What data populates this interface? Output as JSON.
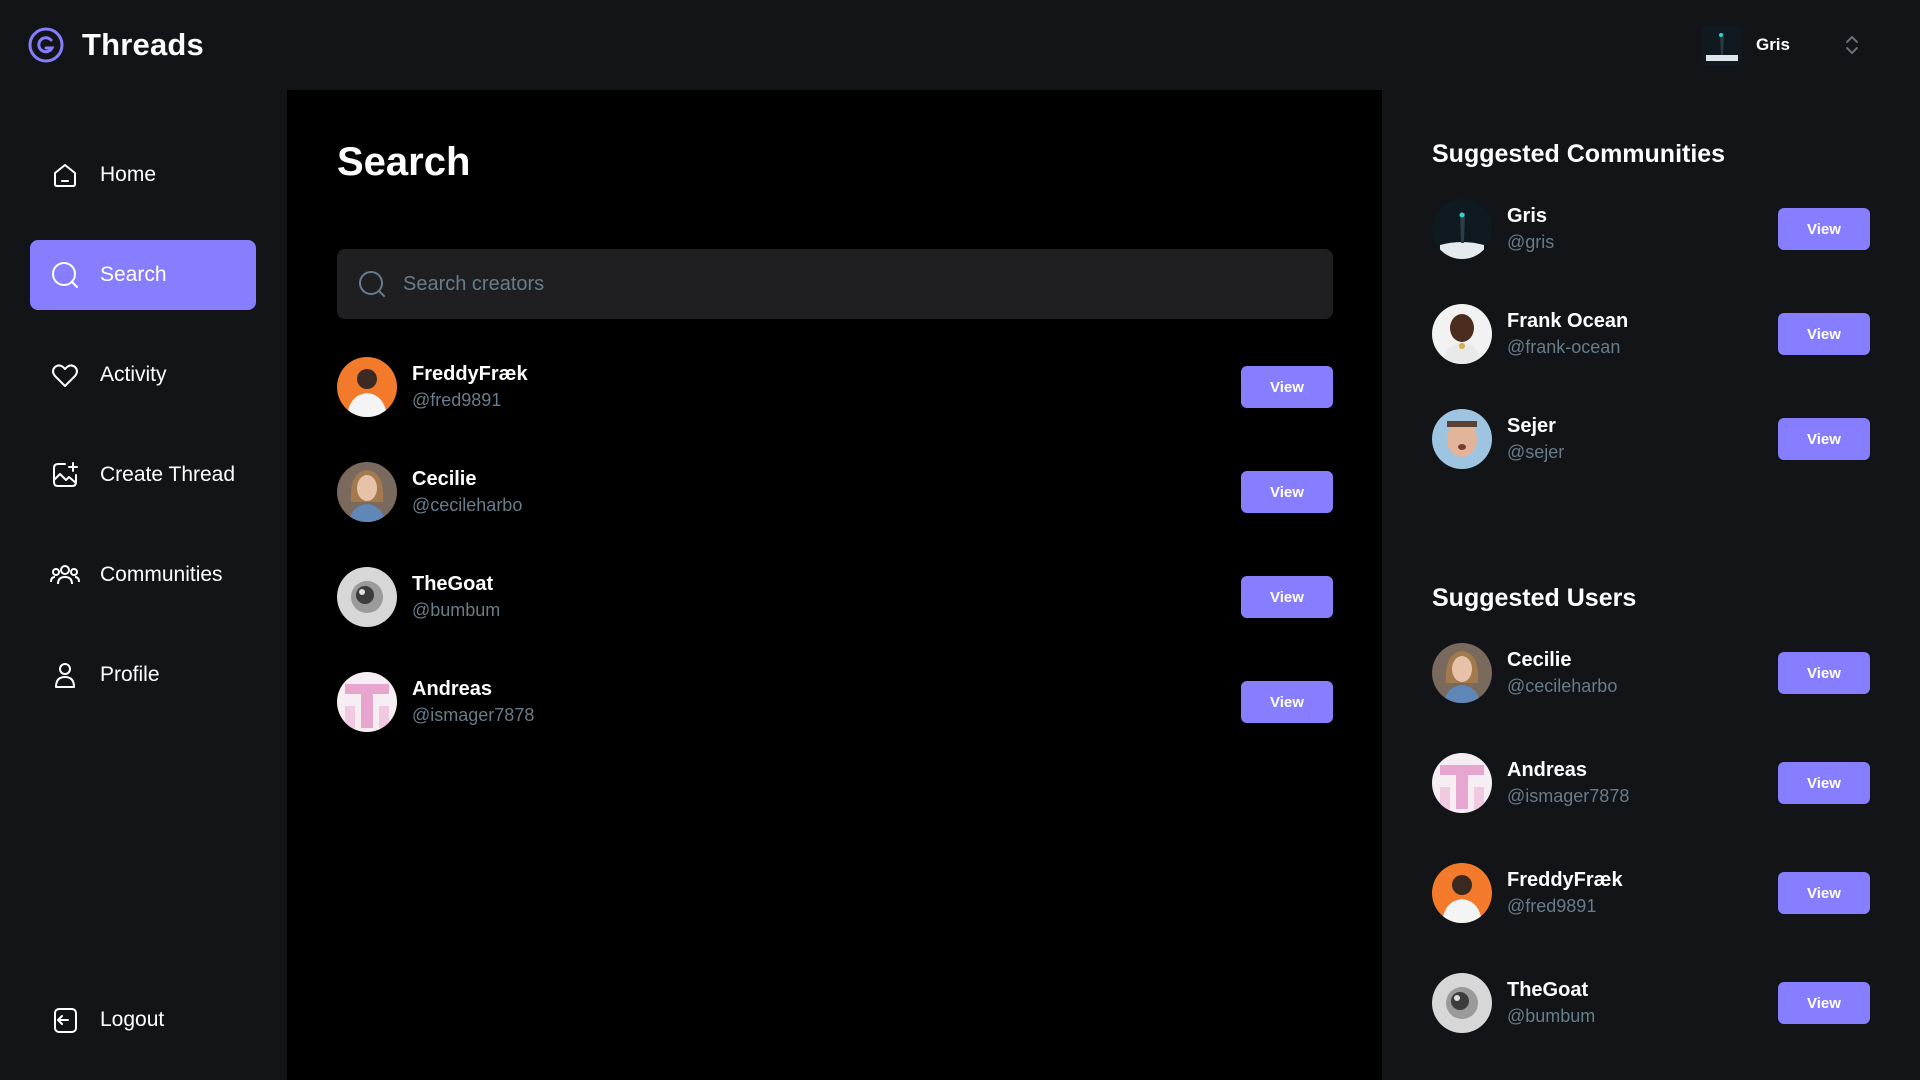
{
  "app": {
    "title": "Threads"
  },
  "account": {
    "name": "Gris"
  },
  "nav": {
    "items": [
      {
        "label": "Home",
        "icon": "home-icon"
      },
      {
        "label": "Search",
        "icon": "search-icon"
      },
      {
        "label": "Activity",
        "icon": "heart-icon"
      },
      {
        "label": "Create Thread",
        "icon": "create-thread-icon"
      },
      {
        "label": "Communities",
        "icon": "communities-icon"
      },
      {
        "label": "Profile",
        "icon": "profile-icon"
      }
    ],
    "logout": {
      "label": "Logout",
      "icon": "logout-icon"
    }
  },
  "main": {
    "title": "Search",
    "search": {
      "placeholder": "Search creators",
      "value": ""
    },
    "results": [
      {
        "name": "FreddyFræk",
        "handle": "@fred9891",
        "button": "View"
      },
      {
        "name": "Cecilie",
        "handle": "@cecileharbo",
        "button": "View"
      },
      {
        "name": "TheGoat",
        "handle": "@bumbum",
        "button": "View"
      },
      {
        "name": "Andreas",
        "handle": "@ismager7878",
        "button": "View"
      }
    ]
  },
  "sidebar_right": {
    "communities_title": "Suggested Communities",
    "communities": [
      {
        "name": "Gris",
        "handle": "@gris",
        "button": "View"
      },
      {
        "name": "Frank Ocean",
        "handle": "@frank-ocean",
        "button": "View"
      },
      {
        "name": "Sejer",
        "handle": "@sejer",
        "button": "View"
      }
    ],
    "users_title": "Suggested Users",
    "users": [
      {
        "name": "Cecilie",
        "handle": "@cecileharbo",
        "button": "View"
      },
      {
        "name": "Andreas",
        "handle": "@ismager7878",
        "button": "View"
      },
      {
        "name": "FreddyFræk",
        "handle": "@fred9891",
        "button": "View"
      },
      {
        "name": "TheGoat",
        "handle": "@bumbum",
        "button": "View"
      }
    ]
  },
  "colors": {
    "accent": "#877EFF",
    "bg_dark": "#121417",
    "bg_main": "#000000",
    "input_bg": "#1F1F22",
    "muted_text": "#697C89"
  }
}
